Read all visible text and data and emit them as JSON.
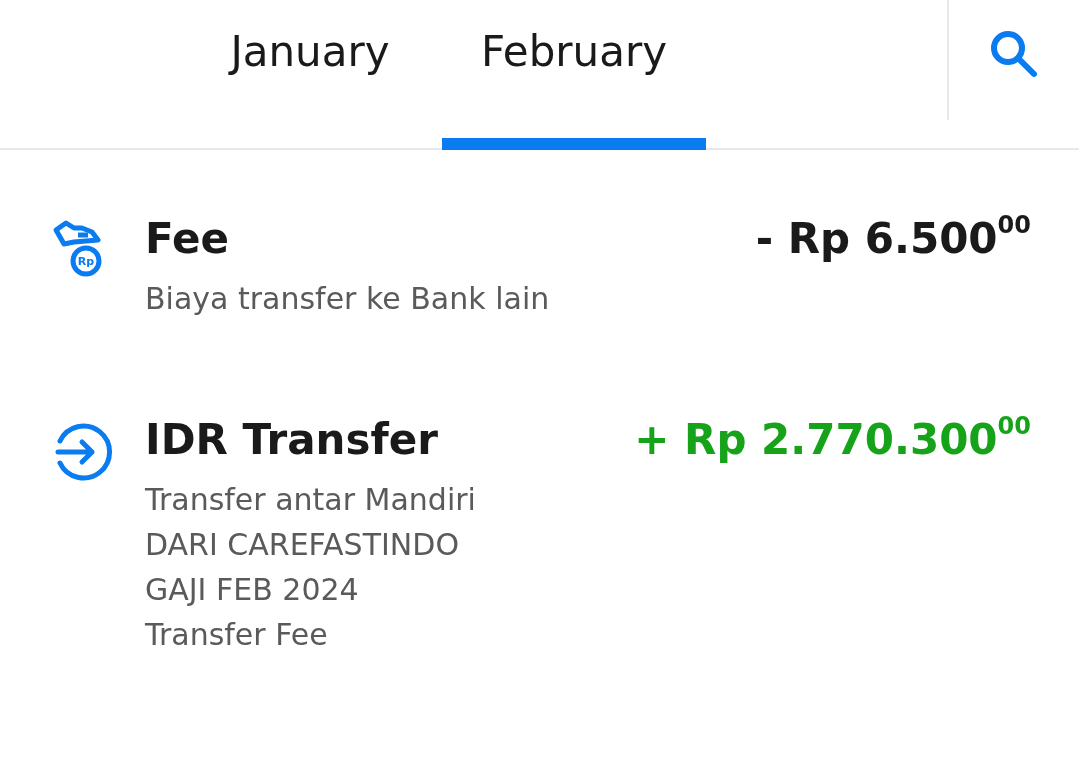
{
  "tabs": [
    {
      "label": "January",
      "selected": false
    },
    {
      "label": "February",
      "selected": true
    }
  ],
  "transactions": [
    {
      "kind": "fee",
      "icon_label": "Rp",
      "title": "Fee",
      "amount": "- Rp 6.500$^{00}$",
      "incoming": false,
      "details": [
        "Biaya transfer ke Bank lain"
      ]
    },
    {
      "kind": "transfer",
      "title": "IDR Transfer",
      "amount": "+ Rp 2.770.300$^{00}$",
      "incoming": true,
      "details": [
        "Transfer antar Mandiri",
        "DARI CAREFASTINDO",
        "GAJI FEB 2024",
        "Transfer Fee"
      ]
    }
  ]
}
